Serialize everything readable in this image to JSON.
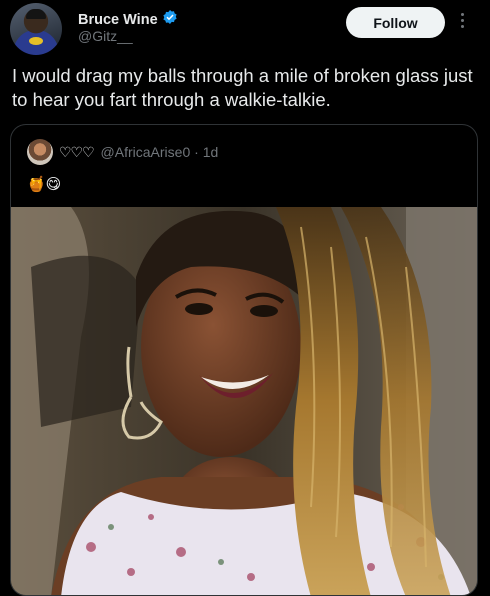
{
  "author": {
    "name": "Bruce Wine",
    "handle": "@Gitz__",
    "verified": true
  },
  "actions": {
    "follow_label": "Follow"
  },
  "tweet": {
    "text": "I would drag my balls through a mile of broken glass just to hear you fart through a walkie-talkie."
  },
  "quoted": {
    "name_hearts": "♡♡♡",
    "handle": "@AfricaArise0",
    "separator": "·",
    "time": "1d",
    "text_emojis": "🍯😋"
  },
  "colors": {
    "background": "#000000",
    "text": "#e7e9ea",
    "secondary": "#71767b",
    "verified": "#1d9bf0",
    "follow_bg": "#eff3f4"
  },
  "icons": [
    "verified-badge-icon",
    "more-options-icon"
  ]
}
